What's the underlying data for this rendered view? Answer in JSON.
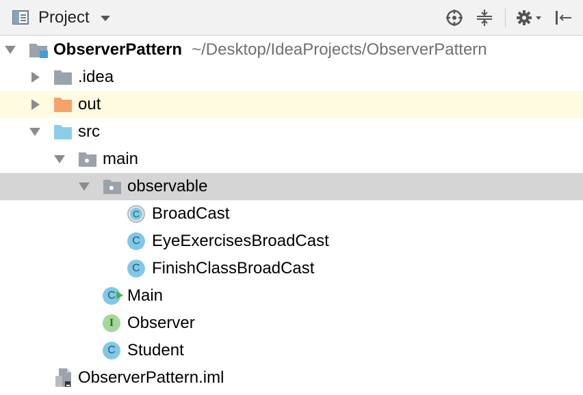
{
  "toolbar": {
    "title": "Project",
    "buttons": {
      "locate": "crosshair-icon",
      "collapse": "collapse-all-icon",
      "settings": "gear-icon",
      "hide": "hide-panel-icon"
    }
  },
  "tree": {
    "root": {
      "name": "ObserverPattern",
      "path": "~/Desktop/IdeaProjects/ObserverPattern"
    },
    "idea": {
      "name": ".idea"
    },
    "out": {
      "name": "out"
    },
    "src": {
      "name": "src"
    },
    "main": {
      "name": "main"
    },
    "observable": {
      "name": "observable"
    },
    "broadcast": {
      "name": "BroadCast",
      "badge": "C"
    },
    "eye": {
      "name": "EyeExercisesBroadCast",
      "badge": "C"
    },
    "finish": {
      "name": "FinishClassBroadCast",
      "badge": "C"
    },
    "mainClass": {
      "name": "Main",
      "badge": "C"
    },
    "observer": {
      "name": "Observer",
      "badge": "I"
    },
    "student": {
      "name": "Student",
      "badge": "C"
    },
    "iml": {
      "name": "ObserverPattern.iml"
    }
  },
  "colors": {
    "selected_row": "#d5d5d5",
    "current_row": "#fefbe1",
    "folder_gray": "#9aa3ab",
    "folder_out": "#f4a26b",
    "folder_src": "#8ccde7",
    "class_badge": "#82c8e6",
    "interface_badge": "#a5d69a"
  }
}
